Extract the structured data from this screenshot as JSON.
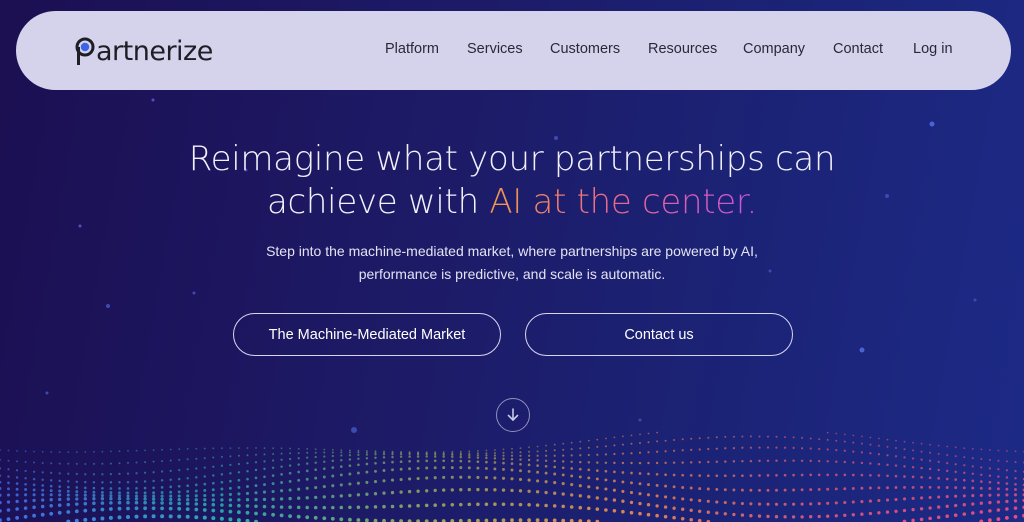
{
  "nav": {
    "logo_text": "artnerize",
    "links": [
      "Platform",
      "Services",
      "Customers",
      "Resources",
      "Company",
      "Contact",
      "Log in"
    ]
  },
  "hero": {
    "title_line1": "Reimagine what your partnerships can",
    "title_line2_plain": "achieve with ",
    "title_line2_highlight": "AI at the center.",
    "subtitle_line1": "Step into the machine-mediated market, where partnerships are powered by AI,",
    "subtitle_line2": "performance is predictive, and scale is automatic.",
    "primary_button": "The Machine-Mediated Market",
    "secondary_button": "Contact us"
  },
  "icons": {
    "logo": "partnerize-logo-icon",
    "scroll": "arrow-down-circle-icon"
  },
  "colors": {
    "background_start": "#1c0f52",
    "background_end": "#1d2a86",
    "nav_background": "#d5d3ec",
    "highlight_start": "#f29a4a",
    "highlight_end": "#c653d9"
  }
}
